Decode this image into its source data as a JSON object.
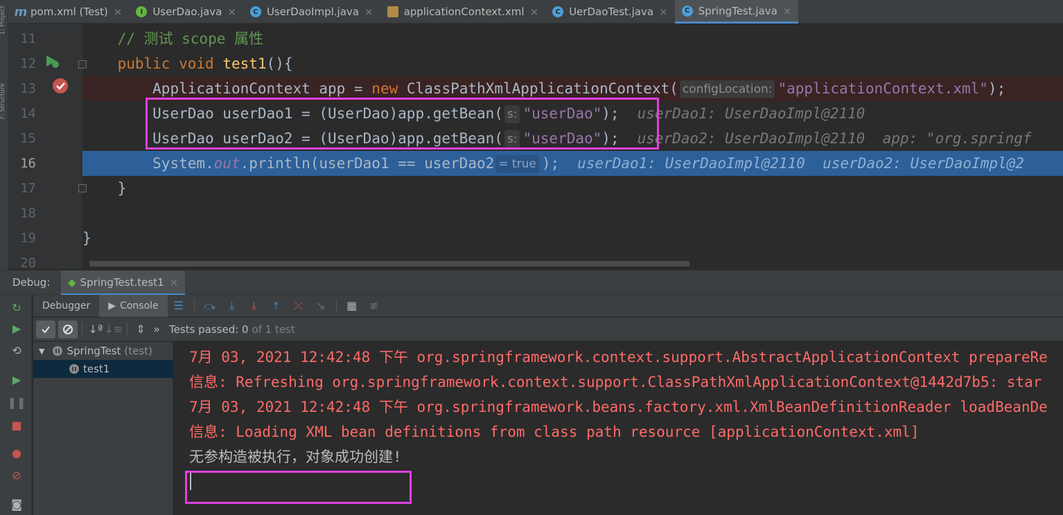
{
  "tabs": [
    {
      "label": "pom.xml (Test)",
      "icon": "maven-icon"
    },
    {
      "label": "UserDao.java",
      "icon": "interface-icon"
    },
    {
      "label": "UserDaoImpl.java",
      "icon": "class-icon"
    },
    {
      "label": "applicationContext.xml",
      "icon": "xml-icon"
    },
    {
      "label": "UerDaoTest.java",
      "icon": "test-class-icon"
    },
    {
      "label": "SpringTest.java",
      "icon": "test-class-icon",
      "active": true
    }
  ],
  "editor": {
    "lines": {
      "l11": {
        "num": "11",
        "comment": "// 测试 scope 属性"
      },
      "l12": {
        "num": "12",
        "kw1": "public",
        "kw2": "void",
        "name": "test1",
        "rest": "(){"
      },
      "l13": {
        "num": "13",
        "type": "ApplicationContext",
        "var": "app",
        "eq": "=",
        "kw": "new",
        "cls": "ClassPathXmlApplicationContext(",
        "hint": "configLocation:",
        "str": "\"applicationContext.xml\"",
        "end": ");"
      },
      "l14": {
        "num": "14",
        "code": "UserDao userDao1 = (UserDao)app.getBean(",
        "hint": "s:",
        "str": "\"userDao\"",
        "end": ");",
        "inline": "userDao1: UserDaoImpl@2110"
      },
      "l15": {
        "num": "15",
        "code": "UserDao userDao2 = (UserDao)app.getBean(",
        "hint": "s:",
        "str": "\"userDao\"",
        "end": ");",
        "inline": "userDao2: UserDaoImpl@2110  app: \"org.springf"
      },
      "l16": {
        "num": "16",
        "pre": "System.",
        "field": "out",
        "code": ".println(userDao1 == userDao2",
        "hint": "= true",
        "end": ");",
        "inline": "userDao1: UserDaoImpl@2110  userDao2: UserDaoImpl@2"
      },
      "l17": {
        "num": "17",
        "code": "}"
      },
      "l18": {
        "num": "18"
      },
      "l19": {
        "num": "19",
        "code": "}"
      },
      "l20": {
        "num": "20"
      }
    }
  },
  "debug": {
    "label": "Debug:",
    "session_tab": "SpringTest.test1",
    "tabs": {
      "debugger": "Debugger",
      "console": "Console"
    },
    "tests_status": {
      "prefix": "Tests passed: ",
      "count": "0",
      "suffix": " of 1 test"
    },
    "tree": {
      "root": "SpringTest",
      "root_note": "(test)",
      "child": "test1"
    },
    "console_lines": [
      {
        "text": "7月 03, 2021 12:42:48 下午 org.springframework.context.support.AbstractApplicationContext prepareRe",
        "kind": "red"
      },
      {
        "text": "信息: Refreshing org.springframework.context.support.ClassPathXmlApplicationContext@1442d7b5: star",
        "kind": "red"
      },
      {
        "text": "7月 03, 2021 12:42:48 下午 org.springframework.beans.factory.xml.XmlBeanDefinitionReader loadBeanDe",
        "kind": "red"
      },
      {
        "text": "信息: Loading XML bean definitions from class path resource [applicationContext.xml]",
        "kind": "red"
      },
      {
        "text": "无参构造被执行，对象成功创建!",
        "kind": "norm"
      }
    ]
  },
  "colors": {
    "highlight_box": "#e040e0",
    "current_line": "#2d6099",
    "error_text": "#ff6b68"
  }
}
